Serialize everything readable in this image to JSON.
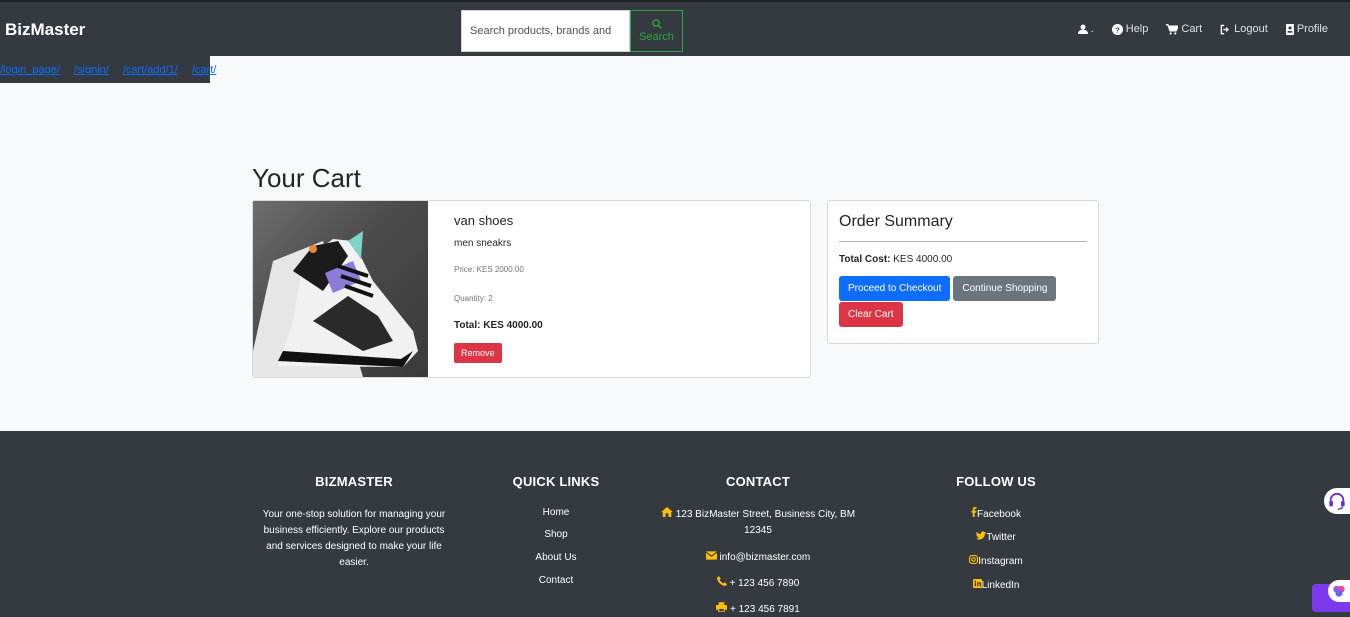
{
  "navbar": {
    "brand": "BizMaster",
    "search_placeholder": "Search products, brands and",
    "search_label": "Search",
    "user_label": ".",
    "help": "Help",
    "cart": "Cart",
    "logout": "Logout",
    "profile": "Profile"
  },
  "breadcrumbs": [
    "/login_page/",
    "/signin/",
    "/cart/add/1/",
    "/cart/"
  ],
  "page_title": "Your Cart",
  "cart_item": {
    "name": "van shoes",
    "description": "men sneakrs",
    "price": "Price: KES 2000.00",
    "quantity": "Quantity: 2",
    "total": "Total: KES 4000.00",
    "remove_label": "Remove"
  },
  "summary": {
    "title": "Order Summary",
    "total_label": "Total Cost:",
    "total_value": "KES 4000.00",
    "checkout_label": "Proceed to Checkout",
    "continue_label": "Continue Shopping",
    "clear_label": "Clear Cart"
  },
  "footer": {
    "about": {
      "heading": "BIZMASTER",
      "text": "Your one-stop solution for managing your business efficiently. Explore our products and services designed to make your life easier."
    },
    "quick_links": {
      "heading": "QUICK LINKS",
      "items": [
        "Home",
        "Shop",
        "About Us",
        "Contact"
      ]
    },
    "contact": {
      "heading": "CONTACT",
      "address": "123 BizMaster Street, Business City, BM 12345",
      "email": "info@bizmaster.com",
      "phone": "+ 123 456 7890",
      "fax": "+ 123 456 7891"
    },
    "follow": {
      "heading": "FOLLOW US",
      "items": [
        "Facebook",
        "Twitter",
        "Instagram",
        "LinkedIn"
      ]
    }
  },
  "colors": {
    "navbar_bg": "#343a40",
    "primary": "#0d6efd",
    "danger": "#dc3545",
    "secondary": "#6c757d",
    "success": "#28a745",
    "footer_icon": "#ffc107"
  }
}
